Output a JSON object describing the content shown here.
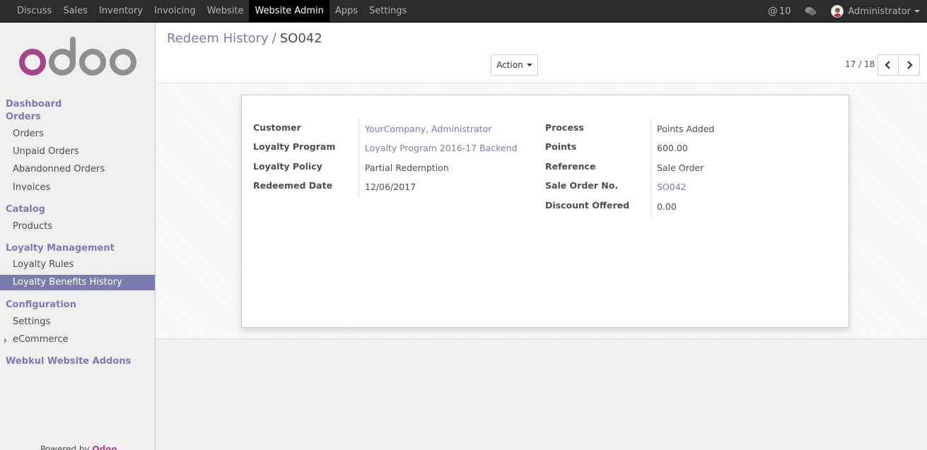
{
  "topbar": {
    "menu": [
      "Discuss",
      "Sales",
      "Inventory",
      "Invoicing",
      "Website",
      "Website Admin",
      "Apps",
      "Settings"
    ],
    "active_index": 5,
    "mentions_count": "10",
    "user_name": "Administrator"
  },
  "sidebar": {
    "sections": {
      "dashboard": "Dashboard",
      "orders": "Orders",
      "catalog": "Catalog",
      "loyalty": "Loyalty Management",
      "configuration": "Configuration",
      "webkul": "Webkul Website Addons"
    },
    "items": {
      "orders": "Orders",
      "unpaid_orders": "Unpaid Orders",
      "abandoned_orders": "Abandonned Orders",
      "invoices": "Invoices",
      "products": "Products",
      "loyalty_rules": "Loyalty Rules",
      "loyalty_benefits_history": "Loyalty Benefits History",
      "settings": "Settings",
      "ecommerce": "eCommerce"
    },
    "powered_by": "Powered by",
    "powered_brand": "Odoo"
  },
  "control_panel": {
    "breadcrumb_parent": "Redeem History",
    "breadcrumb_sep": "/",
    "breadcrumb_current": "SO042",
    "action_label": "Action",
    "pager": "17 / 18"
  },
  "form": {
    "left": [
      {
        "label": "Customer",
        "value": "YourCompany, Administrator",
        "link": true
      },
      {
        "label": "Loyalty Program",
        "value": "Loyalty Program 2016-17 Backend",
        "link": true
      },
      {
        "label": "Loyalty Policy",
        "value": "Partial Redemption",
        "link": false
      },
      {
        "label": "Redeemed Date",
        "value": "12/06/2017",
        "link": false
      }
    ],
    "right": [
      {
        "label": "Process",
        "value": "Points Added",
        "link": false
      },
      {
        "label": "Points",
        "value": "600.00",
        "link": false
      },
      {
        "label": "Reference",
        "value": "Sale Order",
        "link": false
      },
      {
        "label": "Sale Order No.",
        "value": "SO042",
        "link": true
      },
      {
        "label": "Discount Offered",
        "value": "0.00",
        "link": false
      }
    ]
  },
  "colors": {
    "brand_purple": "#7c7bad",
    "odoo_magenta": "#a24689",
    "navbar": "#2c2c2c"
  }
}
